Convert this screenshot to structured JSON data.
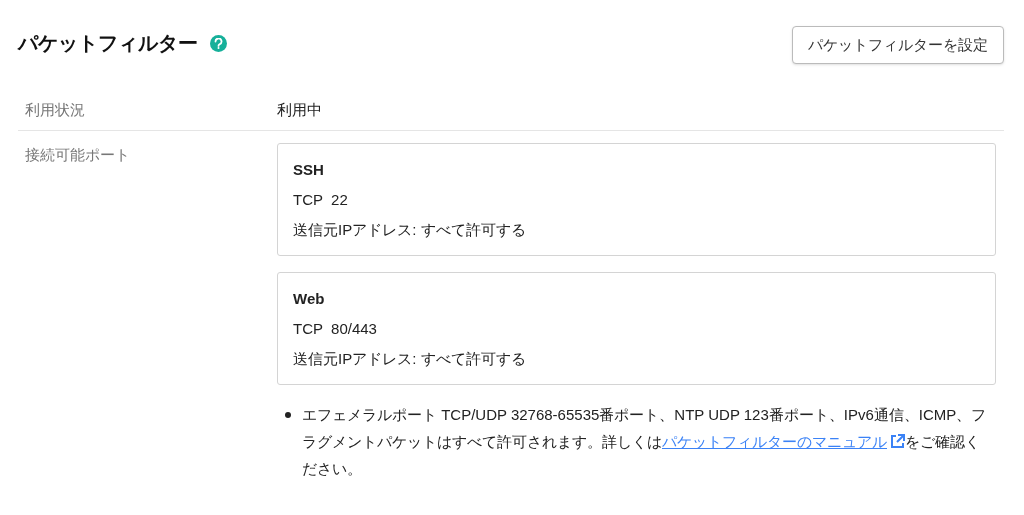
{
  "header": {
    "title": "パケットフィルター",
    "button": "パケットフィルターを設定"
  },
  "rows": [
    {
      "label": "利用状況",
      "value": "利用中"
    },
    {
      "label": "接続可能ポート",
      "ports": [
        {
          "name": "SSH",
          "protocol": "TCP  22",
          "source": "送信元IPアドレス: すべて許可する"
        },
        {
          "name": "Web",
          "protocol": "TCP  80/443",
          "source": "送信元IPアドレス: すべて許可する"
        }
      ],
      "note": {
        "before": "エフェメラルポート TCP/UDP 32768-65535番ポート、NTP UDP 123番ポート、IPv6通信、ICMP、フラグメントパケットはすべて許可されます。詳しくは",
        "link": "パケットフィルターのマニュアル",
        "after": "をご確認ください。"
      }
    }
  ]
}
